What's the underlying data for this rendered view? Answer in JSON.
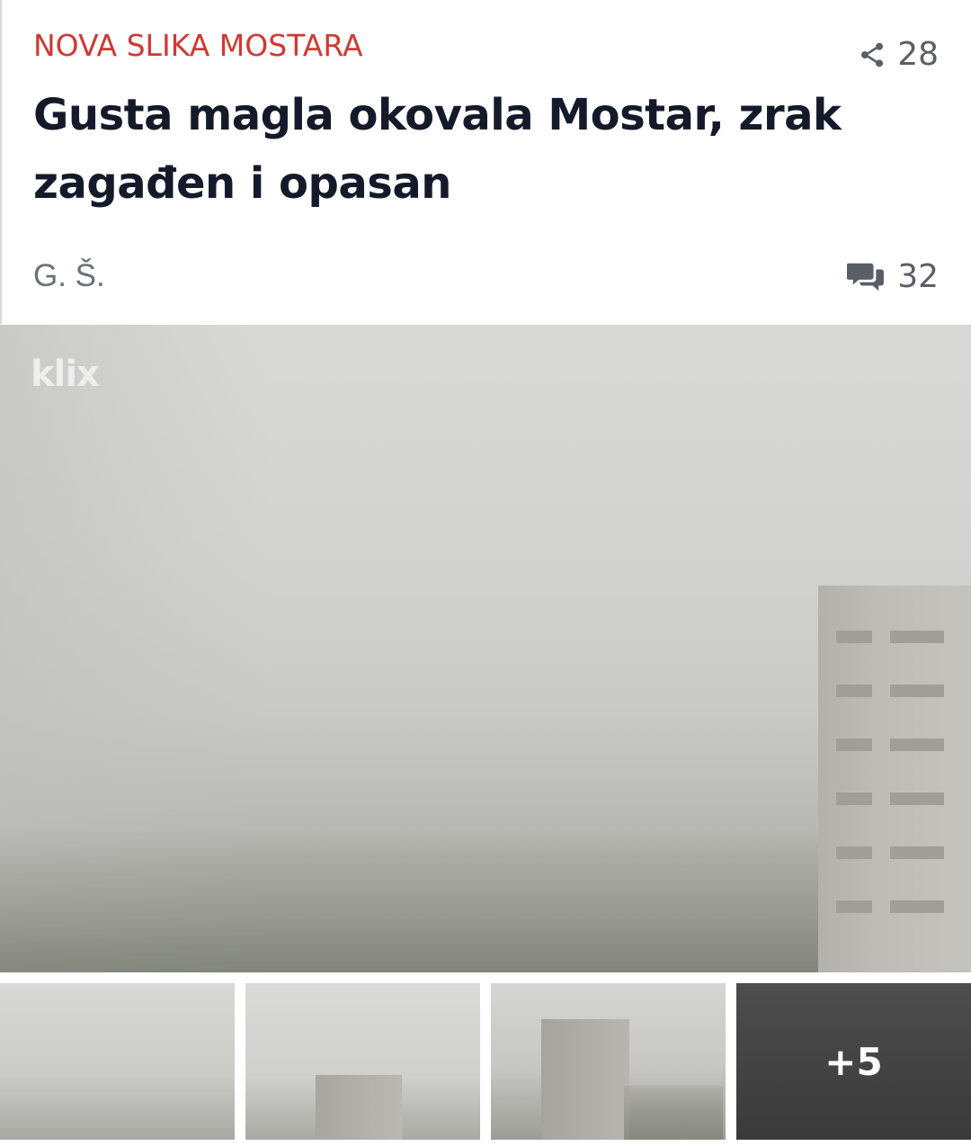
{
  "article": {
    "kicker": "NOVA SLIKA MOSTARA",
    "headline": "Gusta magla okovala Mostar, zrak zagađen i opasan",
    "author": "G. Š.",
    "share_count": "28",
    "comment_count": "32"
  },
  "gallery": {
    "watermark": "klix",
    "more_label": "+5"
  },
  "colors": {
    "kicker": "#cf3a34",
    "headline": "#151a2b",
    "meta": "#5a5f66"
  },
  "icons": {
    "share": "share-icon",
    "comments": "comments-icon"
  }
}
